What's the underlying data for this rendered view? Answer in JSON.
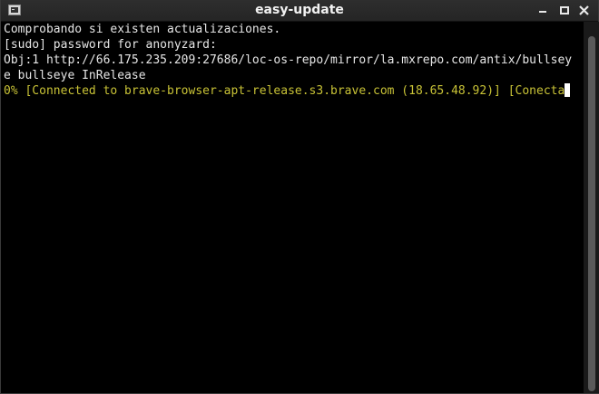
{
  "window": {
    "title": "easy-update",
    "controls": {
      "minimize_icon": "minimize-icon",
      "maximize_icon": "maximize-icon",
      "close_icon": "close-icon"
    }
  },
  "terminal": {
    "lines": [
      "Comprobando si existen actualizaciones.",
      "[sudo] password for anonyzard:",
      "Obj:1 http://66.175.235.209:27686/loc-os-repo/mirror/la.mxrepo.com/antix/bullsey",
      "e bullseye InRelease",
      "0% [Connected to brave-browser-apt-release.s3.brave.com (18.65.48.92)] [Conecta"
    ],
    "colors": {
      "background": "#000000",
      "text": "#e6e6e6",
      "progress_text": "#c8c236",
      "cursor": "#ffffff"
    }
  }
}
